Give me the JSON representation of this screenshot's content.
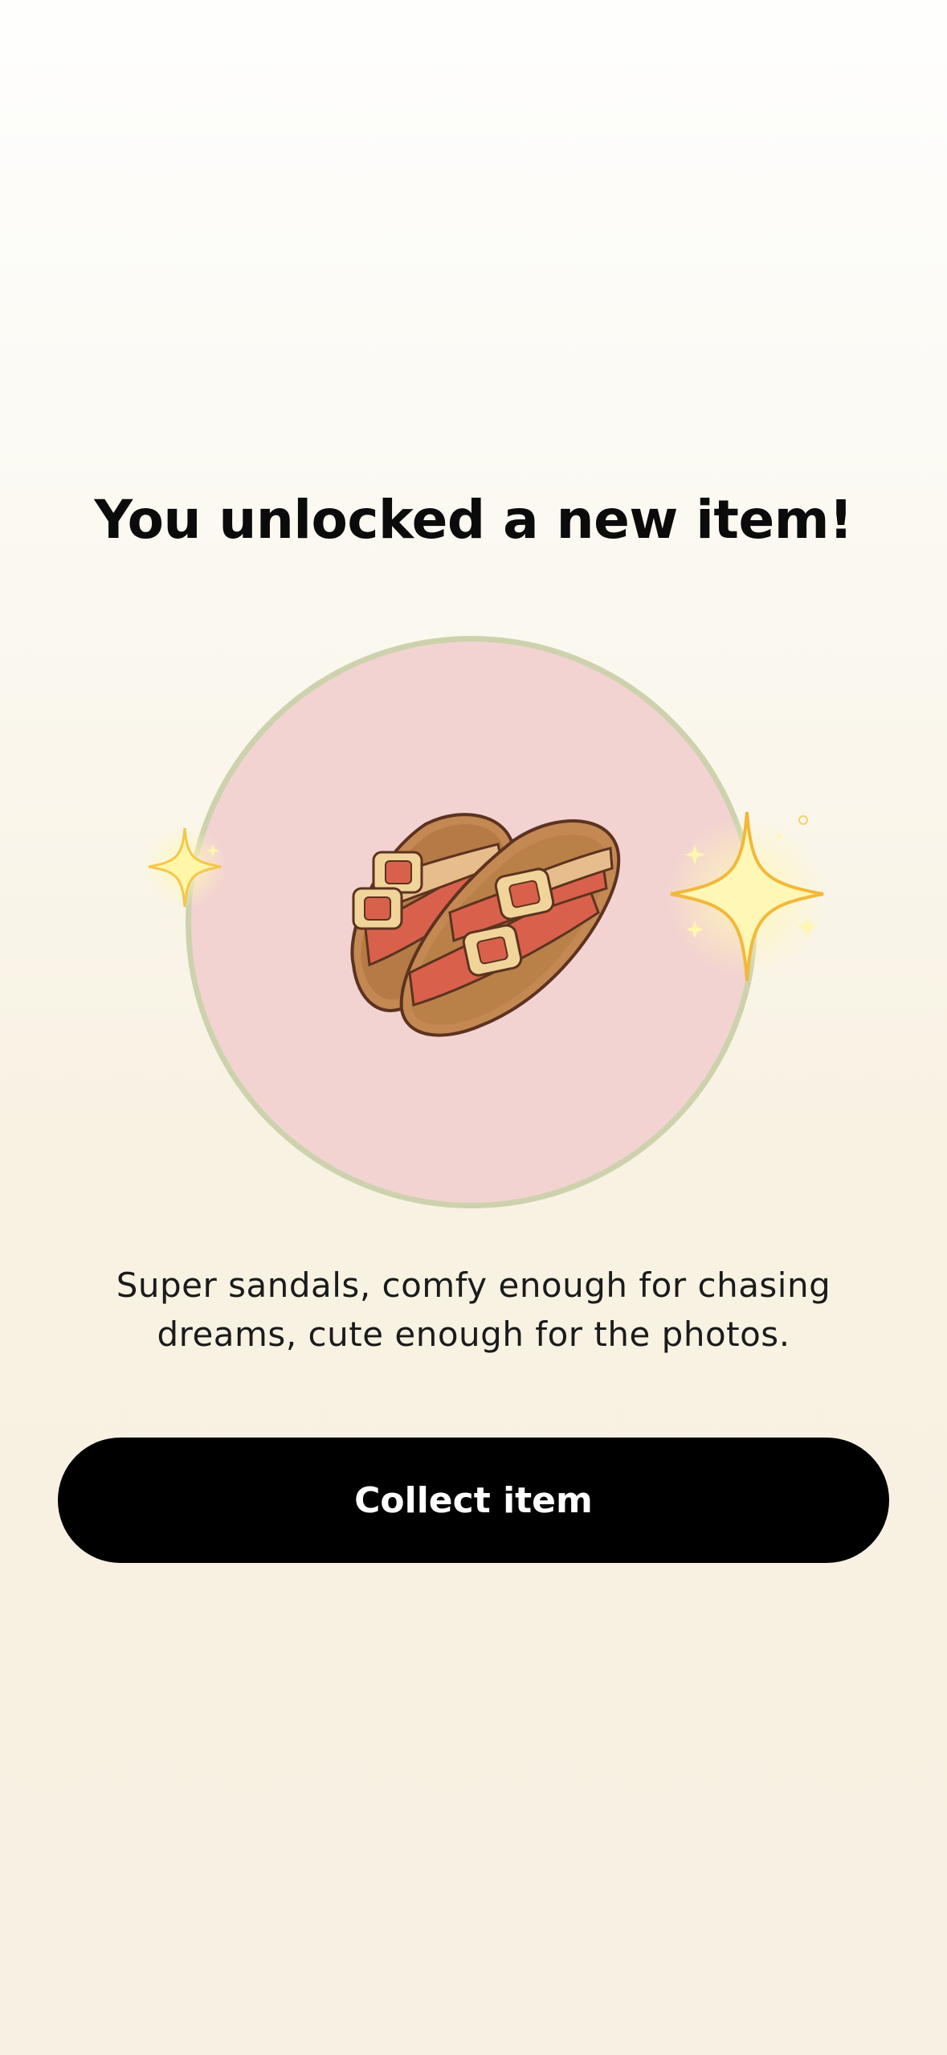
{
  "unlock": {
    "title": "You unlocked a new item!",
    "item_image": "sandals-illustration",
    "description": "Super sandals, comfy enough for chasing dreams, cute enough for the photos.",
    "collect_label": "Collect item"
  },
  "colors": {
    "circle_fill": "#f2d3d1",
    "circle_border": "#cdd2ad",
    "strap": "#d9614c",
    "sole": "#b87e4b",
    "button_bg": "#000000",
    "sparkle": "#fff3a0"
  }
}
